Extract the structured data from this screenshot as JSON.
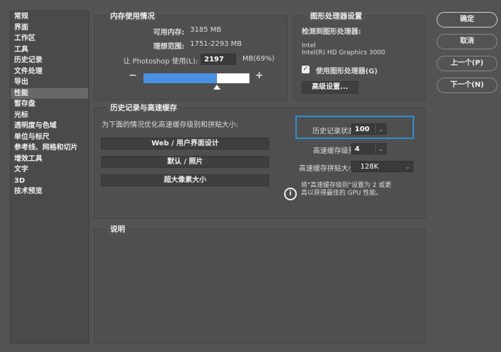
{
  "sidebar": {
    "items": [
      "常规",
      "界面",
      "工作区",
      "工具",
      "历史记录",
      "文件处理",
      "导出",
      "性能",
      "暂存盘",
      "光标",
      "透明度与色域",
      "单位与标尺",
      "参考线、网格和切片",
      "增效工具",
      "文字",
      "3D",
      "技术预览"
    ],
    "active": "性能"
  },
  "memory": {
    "title": "内存使用情况",
    "available_label": "可用内存:",
    "available_value": "3185 MB",
    "ideal_label": "理想范围:",
    "ideal_value": "1751-2293 MB",
    "use_label": "让 Photoshop 使用(L):",
    "use_value": "2197",
    "use_unit": "MB(69%)",
    "slider_percent": 69,
    "minus": "−",
    "plus": "+"
  },
  "gpu": {
    "title": "图形处理器设置",
    "detected_label": "检测到图形处理器:",
    "vendor": "Intel",
    "model": "Intel(R) HD Graphics 3000",
    "use_gpu_label": "使用图形处理器(G)",
    "use_gpu_checked": true,
    "advanced_button": "高级设置..."
  },
  "history": {
    "title": "历史记录与高速缓存",
    "optimize_label": "为下面的情况优化高速缓存级别和拼贴大小:",
    "buttons": [
      "Web / 用户界面设计",
      "默认 / 照片",
      "超大像素大小"
    ],
    "states_label": "历史记录状态(H):",
    "states_value": "100",
    "cache_levels_label": "高速缓存级别(C):",
    "cache_levels_value": "4",
    "tile_size_label": "高速缓存拼贴大小(Z):",
    "tile_size_value": "128K",
    "info_text_1": "将\"高速缓存级别\"设置为 2 或更",
    "info_text_2": "高以获得最佳的 GPU 性能。",
    "highlight_color": "#2f8fd0"
  },
  "description": {
    "title": "说明"
  },
  "actions": {
    "ok": "确定",
    "cancel": "取消",
    "prev": "上一个(P)",
    "next": "下一个(N)"
  }
}
